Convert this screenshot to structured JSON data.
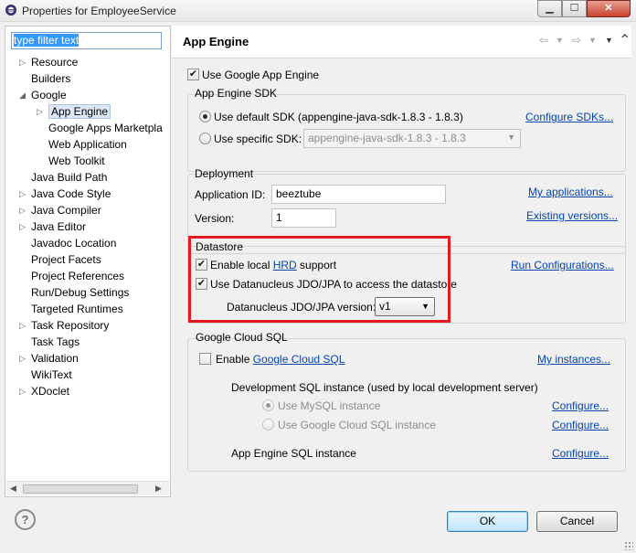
{
  "window": {
    "title": "Properties for EmployeeService"
  },
  "filter": {
    "text": "type filter text"
  },
  "tree": [
    {
      "label": "Resource",
      "twisty": true
    },
    {
      "label": "Builders",
      "twisty": false
    },
    {
      "label": "Google",
      "twisty": "open"
    },
    {
      "label": "App Engine",
      "twisty": true,
      "selected": true
    },
    {
      "label": "Google Apps Marketpla",
      "twisty": false
    },
    {
      "label": "Web Application",
      "twisty": false
    },
    {
      "label": "Web Toolkit",
      "twisty": false
    },
    {
      "label": "Java Build Path",
      "twisty": false
    },
    {
      "label": "Java Code Style",
      "twisty": true
    },
    {
      "label": "Java Compiler",
      "twisty": true
    },
    {
      "label": "Java Editor",
      "twisty": true
    },
    {
      "label": "Javadoc Location",
      "twisty": false
    },
    {
      "label": "Project Facets",
      "twisty": false
    },
    {
      "label": "Project References",
      "twisty": false
    },
    {
      "label": "Run/Debug Settings",
      "twisty": false
    },
    {
      "label": "Targeted Runtimes",
      "twisty": false
    },
    {
      "label": "Task Repository",
      "twisty": true
    },
    {
      "label": "Task Tags",
      "twisty": false
    },
    {
      "label": "Validation",
      "twisty": true
    },
    {
      "label": "WikiText",
      "twisty": false
    },
    {
      "label": "XDoclet",
      "twisty": true
    }
  ],
  "page": {
    "title": "App Engine",
    "use_gae_label": "Use Google App Engine",
    "sdk": {
      "group": "App Engine SDK",
      "default_label": "Use default SDK (appengine-java-sdk-1.8.3 - 1.8.3)",
      "configure_link": "Configure SDKs...",
      "specific_label": "Use specific SDK:",
      "specific_value": "appengine-java-sdk-1.8.3 - 1.8.3"
    },
    "deployment": {
      "group": "Deployment",
      "app_id_label": "Application ID:",
      "app_id_value": "beeztube",
      "version_label": "Version:",
      "version_value": "1",
      "my_apps_link": "My applications...",
      "existing_versions_link": "Existing versions..."
    },
    "datastore": {
      "group": "Datastore",
      "hrd_prefix": "Enable local ",
      "hrd_link": "HRD",
      "hrd_suffix": " support",
      "run_config_link": "Run Configurations...",
      "datanucleus_label": "Use Datanucleus JDO/JPA to access the datastore",
      "version_label": "Datanucleus JDO/JPA version:",
      "version_value": "v1"
    },
    "cloudsql": {
      "group": "Google Cloud SQL",
      "enable_prefix": "Enable ",
      "enable_link": "Google Cloud SQL",
      "my_instances_link": "My instances...",
      "dev_label": "Development SQL instance (used by local development server)",
      "mysql_label": "Use MySQL instance",
      "gcs_label": "Use Google Cloud SQL instance",
      "configure1": "Configure...",
      "configure2": "Configure...",
      "ae_sql_label": "App Engine SQL instance",
      "configure3": "Configure..."
    }
  },
  "buttons": {
    "ok": "OK",
    "cancel": "Cancel",
    "help": "?"
  },
  "colors": {
    "highlight": "#e11a22",
    "link": "#0645ad"
  }
}
